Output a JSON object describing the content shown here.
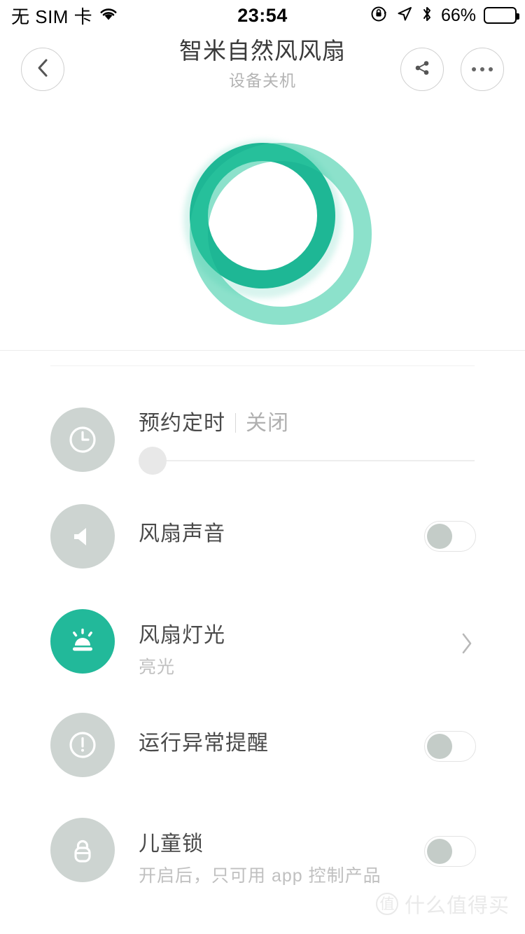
{
  "status_bar": {
    "carrier": "无 SIM 卡",
    "wifi_icon": "wifi-icon",
    "time": "23:54",
    "rotation_lock_icon": "rotation-lock-icon",
    "location_icon": "location-arrow-icon",
    "bluetooth_icon": "bluetooth-icon",
    "battery_percent": "66%",
    "battery_level": 66
  },
  "nav": {
    "back_icon": "chevron-left-icon",
    "share_icon": "share-icon",
    "more_icon": "more-dots-icon",
    "title": "智米自然风风扇",
    "subtitle": "设备关机"
  },
  "power": {
    "ring_icon": "power-ring-icon",
    "ring_color": "#1eb795",
    "state": "off"
  },
  "settings": [
    {
      "icon": "clock-icon",
      "title": "预约定时",
      "value": "关闭",
      "control": "slider",
      "slider_position": 0,
      "active": false
    },
    {
      "icon": "speaker-icon",
      "title": "风扇声音",
      "control": "toggle",
      "toggle_on": false,
      "active": false
    },
    {
      "icon": "light-icon",
      "title": "风扇灯光",
      "subtitle": "亮光",
      "control": "chevron",
      "active": true,
      "active_color": "#22b99a"
    },
    {
      "icon": "alert-icon",
      "title": "运行异常提醒",
      "control": "toggle",
      "toggle_on": false,
      "active": false
    },
    {
      "icon": "lock-icon",
      "title": "儿童锁",
      "subtitle": "开启后，只可用 app 控制产品",
      "control": "toggle",
      "toggle_on": false,
      "active": false
    }
  ],
  "watermark": {
    "logo_char": "值",
    "text": "什么值得买"
  }
}
